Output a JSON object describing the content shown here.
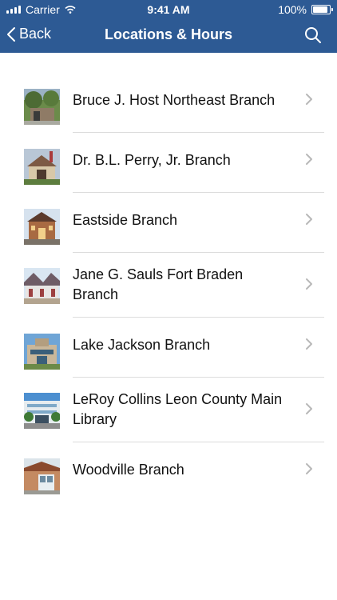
{
  "status_bar": {
    "carrier": "Carrier",
    "time": "9:41 AM",
    "battery": "100%",
    "battery_level": 1.0
  },
  "navbar": {
    "back_label": "Back",
    "title": "Locations & Hours"
  },
  "locations": [
    {
      "name": "Bruce J. Host Northeast Branch"
    },
    {
      "name": "Dr. B.L. Perry, Jr. Branch"
    },
    {
      "name": "Eastside Branch"
    },
    {
      "name": "Jane G. Sauls Fort Braden Branch"
    },
    {
      "name": "Lake Jackson Branch"
    },
    {
      "name": "LeRoy Collins Leon County Main Library"
    },
    {
      "name": "Woodville Branch"
    }
  ],
  "colors": {
    "nav_bar": "#2d5a94",
    "chevron": "#b8b8b8",
    "divider": "#dcdcdc"
  },
  "icons": {
    "back": "chevron-left-icon",
    "search": "search-icon",
    "row_disclosure": "chevron-right-icon"
  }
}
